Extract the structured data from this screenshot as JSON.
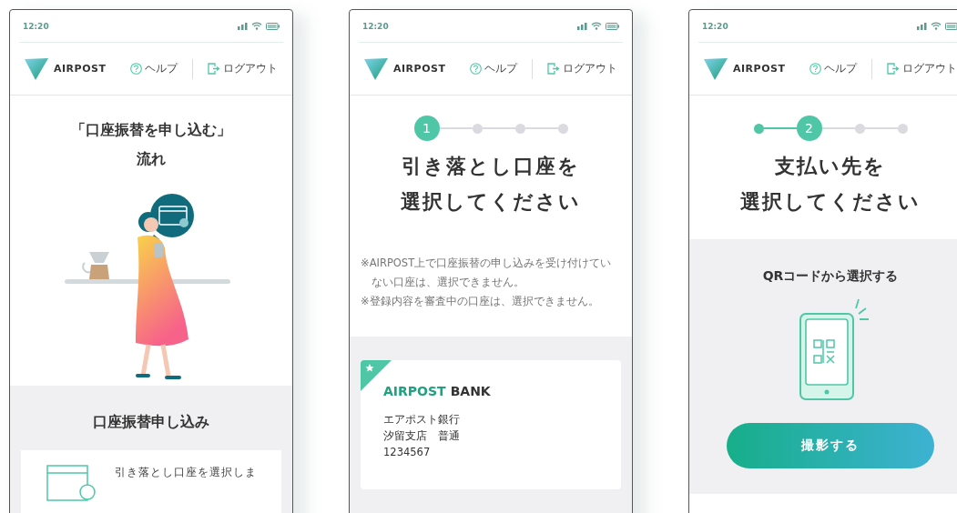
{
  "screens": [
    {
      "kind": "intro",
      "time": "12:20",
      "logo": "AIRPOST",
      "help": "ヘルプ",
      "logout": "ログアウト",
      "title_lines": [
        "「口座振替を申し込む」",
        "流れ"
      ],
      "section_title": "口座振替申し込み",
      "step_card_text": "引き落とし口座を選択しま"
    },
    {
      "kind": "account",
      "time": "12:20",
      "logo": "AIRPOST",
      "help": "ヘルプ",
      "logout": "ログアウト",
      "steps": [
        {
          "kind": "current",
          "label": "1"
        },
        {
          "kind": "pending"
        },
        {
          "kind": "pending"
        },
        {
          "kind": "pending"
        }
      ],
      "title_lines": [
        "引き落とし口座を",
        "選択してください"
      ],
      "notes": [
        "※AIRPOST上で口座振替の申し込みを受け付けていない口座は、選択できません。",
        "※登録内容を審査中の口座は、選択できません。"
      ],
      "accounts": [
        {
          "favorite": true,
          "bank_logo_primary": "AIRPOST",
          "bank_logo_secondary": "BANK",
          "bank_name": "エアポスト銀行",
          "branch": "汐留支店　普通",
          "number": "1234567"
        }
      ]
    },
    {
      "kind": "payee",
      "time": "12:20",
      "logo": "AIRPOST",
      "help": "ヘルプ",
      "logout": "ログアウト",
      "steps": [
        {
          "kind": "done"
        },
        {
          "kind": "current",
          "label": "2"
        },
        {
          "kind": "pending"
        },
        {
          "kind": "pending"
        }
      ],
      "title_lines": [
        "支払い先を",
        "選択してください"
      ],
      "qr_title": "QRコードから選択する",
      "button": "撮影する"
    }
  ]
}
